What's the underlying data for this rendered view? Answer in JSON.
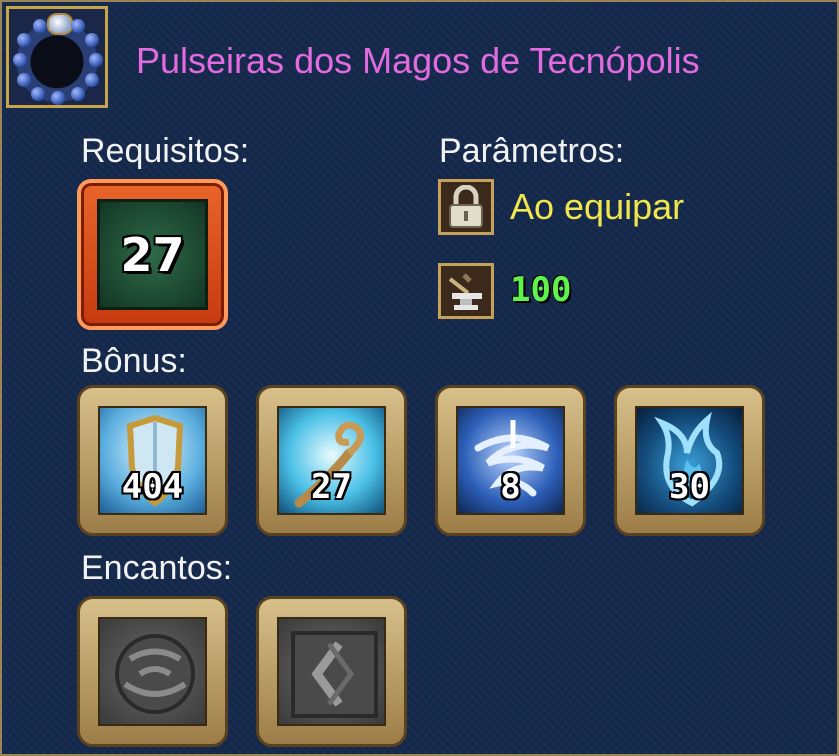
{
  "item": {
    "title": "Pulseiras dos Magos de Tecnópolis",
    "icon": "bracelet-icon"
  },
  "requirements": {
    "label": "Requisitos:",
    "level": "27"
  },
  "parameters": {
    "label": "Parâmetros:",
    "binding": {
      "icon": "lock-icon",
      "text": "Ao equipar"
    },
    "durability": {
      "icon": "anvil-icon",
      "value": "100"
    }
  },
  "bonus": {
    "label": "Bônus:",
    "items": [
      {
        "icon": "ice-shield-icon",
        "value": "404"
      },
      {
        "icon": "frost-staff-icon",
        "value": "27"
      },
      {
        "icon": "water-vortex-icon",
        "value": "8"
      },
      {
        "icon": "blue-flame-icon",
        "value": "30"
      }
    ]
  },
  "enchants": {
    "label": "Encantos:",
    "items": [
      {
        "icon": "empty-rune-slot-icon"
      },
      {
        "icon": "empty-rune-slot-icon"
      }
    ]
  },
  "colors": {
    "title": "#e36be0",
    "binding_text": "#f1e64b",
    "durability_text": "#5ff24d",
    "background": "#15294c"
  }
}
